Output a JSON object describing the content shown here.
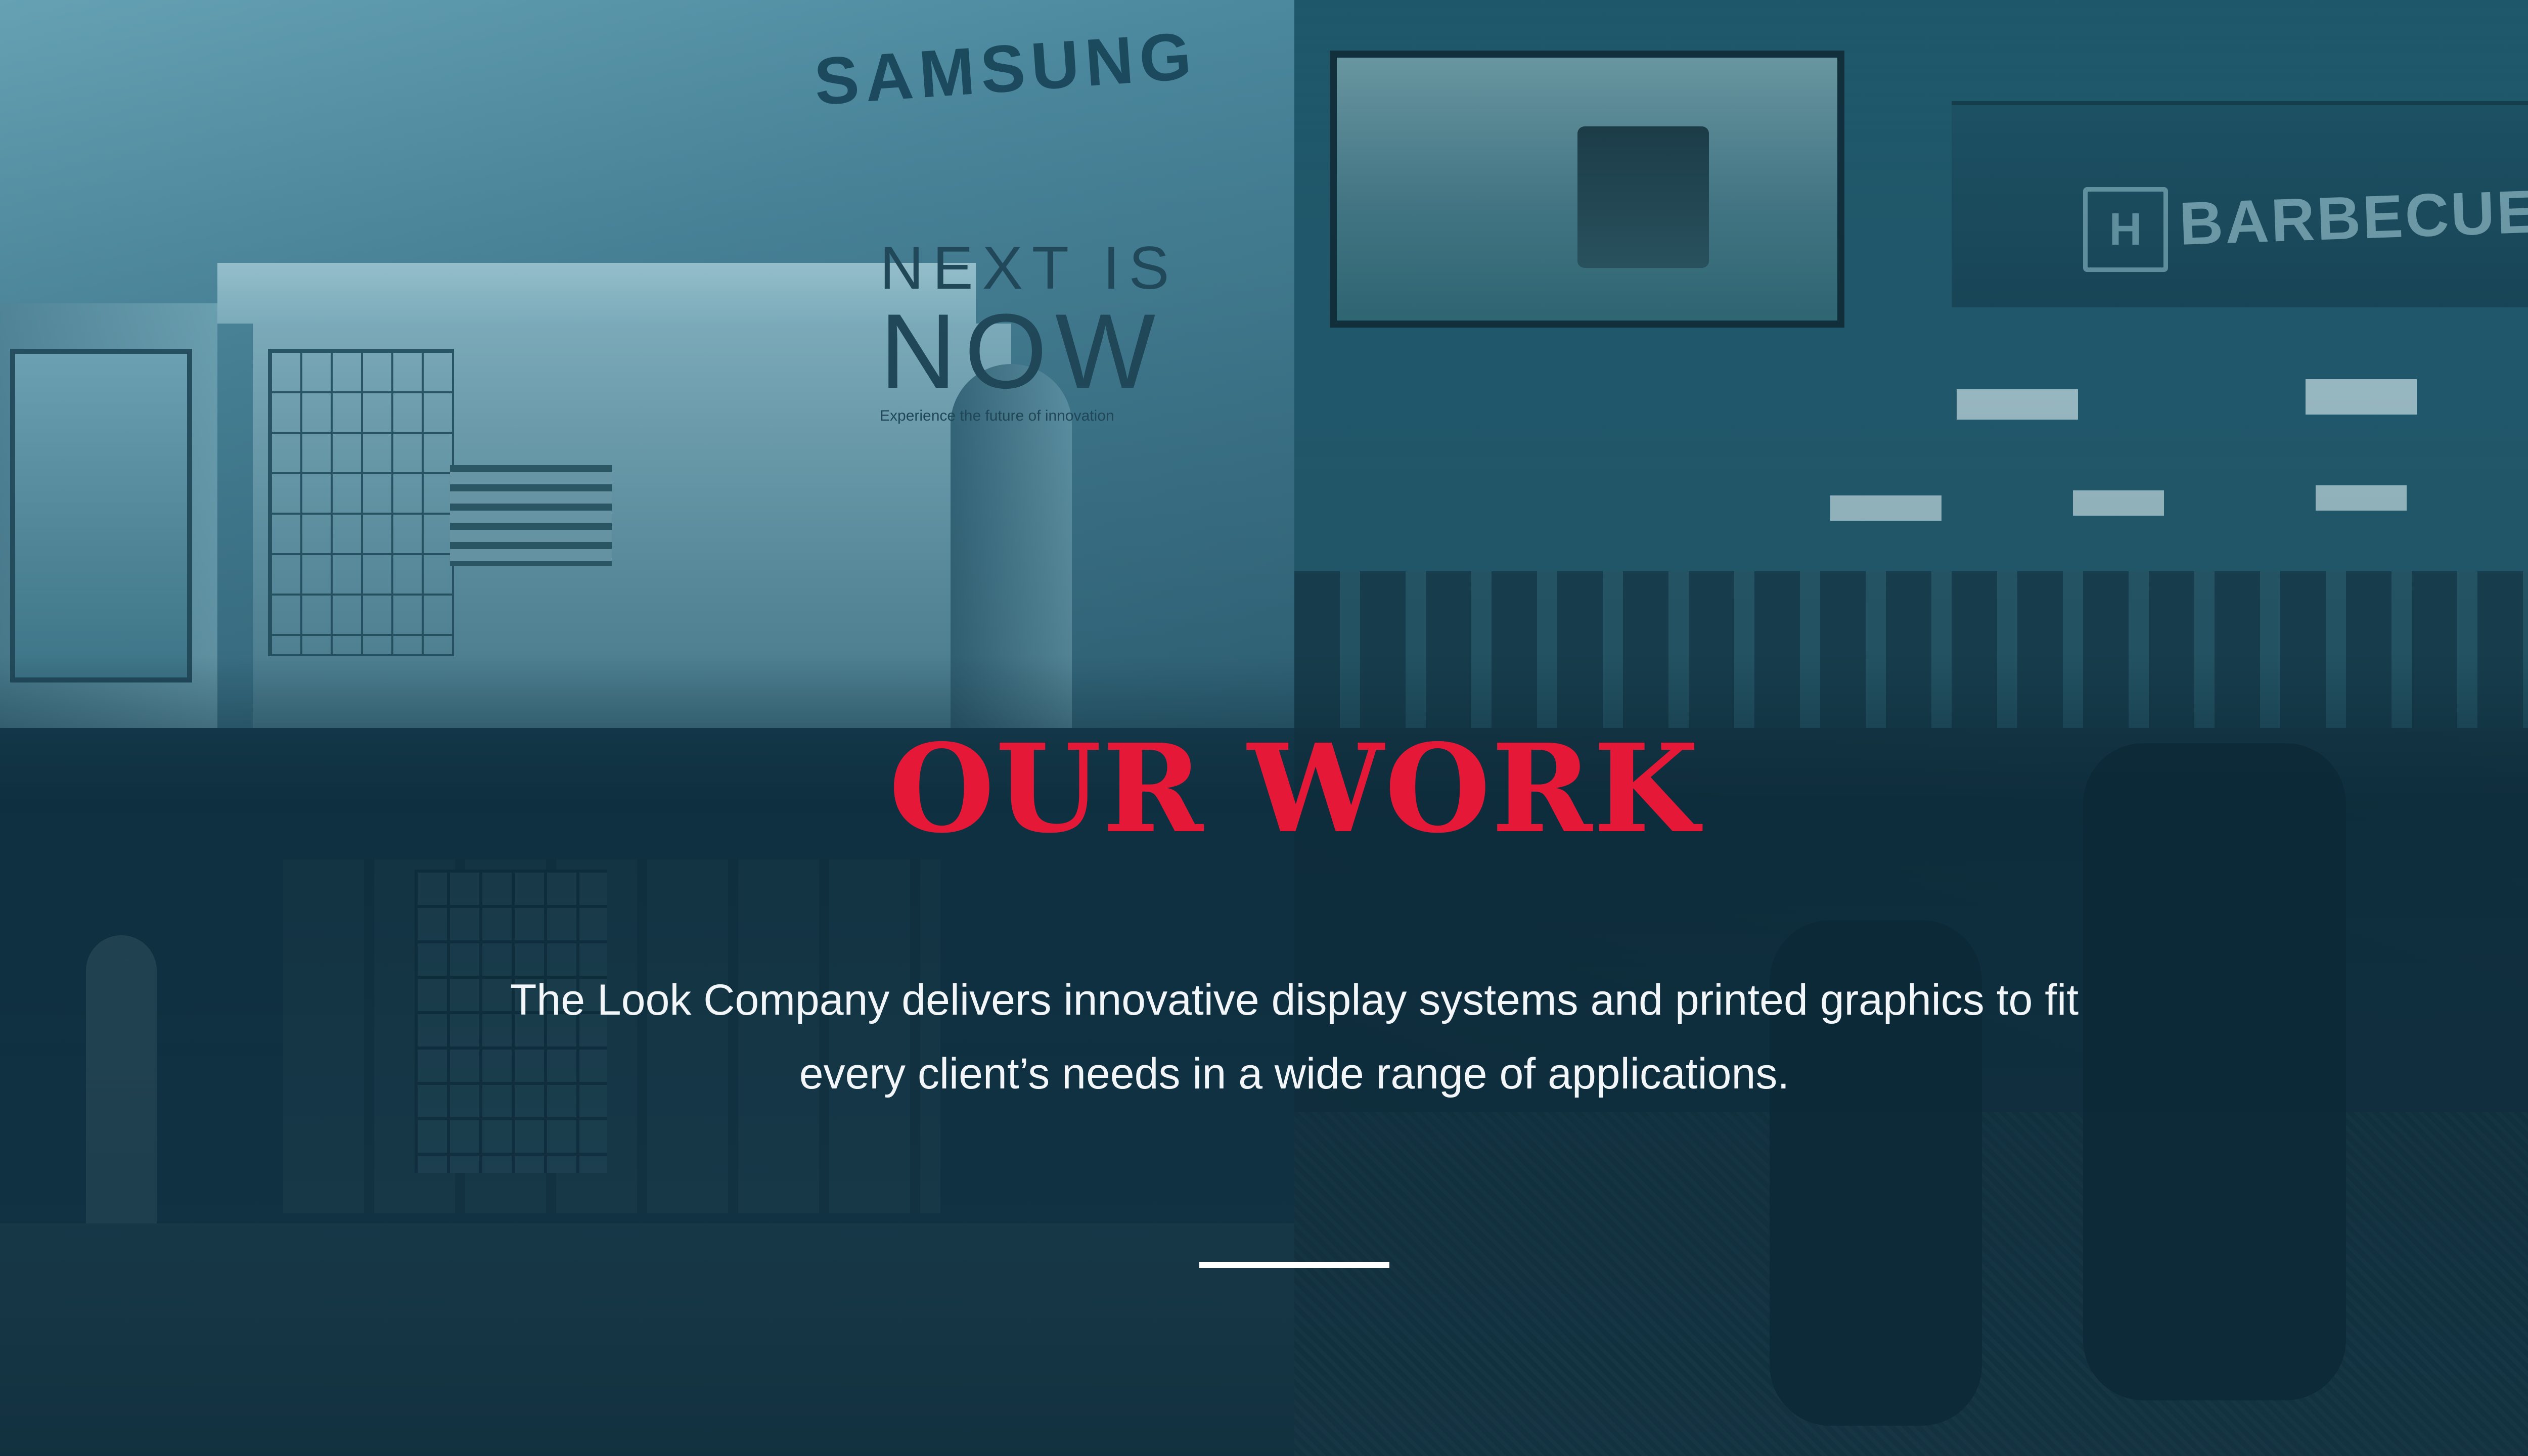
{
  "colors": {
    "background": "#0f2d3c",
    "accent_red": "#e51937",
    "text_light": "#f2f6f8"
  },
  "photos": {
    "top_left": {
      "sign": "SAMSUNG",
      "headline_line1": "NEXT IS",
      "headline_line2": "NOW",
      "tagline": "Experience the future of innovation"
    },
    "top_right": {
      "sign": "BARBECUES",
      "logo_glyph": "H"
    }
  },
  "hero": {
    "title": "OUR WORK",
    "description": "The Look Company delivers innovative display systems and printed graphics to fit every client’s needs in a wide range of applications."
  }
}
